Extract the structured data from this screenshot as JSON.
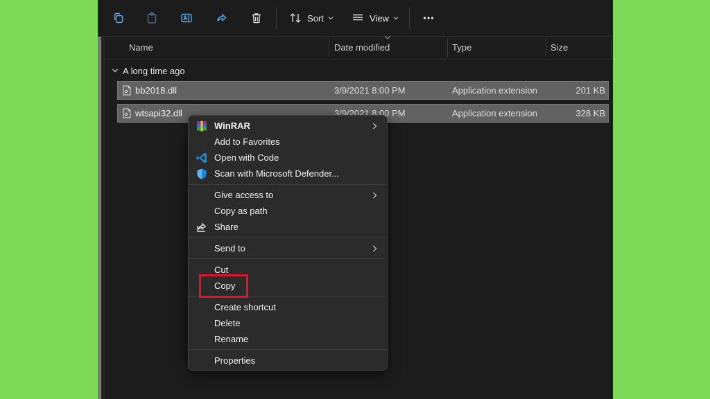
{
  "toolbar": {
    "sort_label": "Sort",
    "view_label": "View"
  },
  "columns": {
    "name": "Name",
    "date": "Date modified",
    "type": "Type",
    "size": "Size"
  },
  "group": {
    "label": "A long time ago"
  },
  "files": [
    {
      "name": "bb2018.dll",
      "date": "3/9/2021 8:00 PM",
      "type": "Application extension",
      "size": "201 KB"
    },
    {
      "name": "wtsapi32.dll",
      "date": "3/9/2021 8:00 PM",
      "type": "Application extension",
      "size": "328 KB"
    }
  ],
  "context_menu": {
    "winrar": "WinRAR",
    "add_favorites": "Add to Favorites",
    "open_code": "Open with Code",
    "scan_defender": "Scan with Microsoft Defender...",
    "give_access": "Give access to",
    "copy_path": "Copy as path",
    "share": "Share",
    "send_to": "Send to",
    "cut": "Cut",
    "copy": "Copy",
    "create_shortcut": "Create shortcut",
    "delete": "Delete",
    "rename": "Rename",
    "properties": "Properties"
  },
  "colors": {
    "background": "#7ed957",
    "window": "#1c1c1c",
    "menu": "#2b2b2b",
    "selection": "#626262",
    "highlight": "#e3132a"
  }
}
